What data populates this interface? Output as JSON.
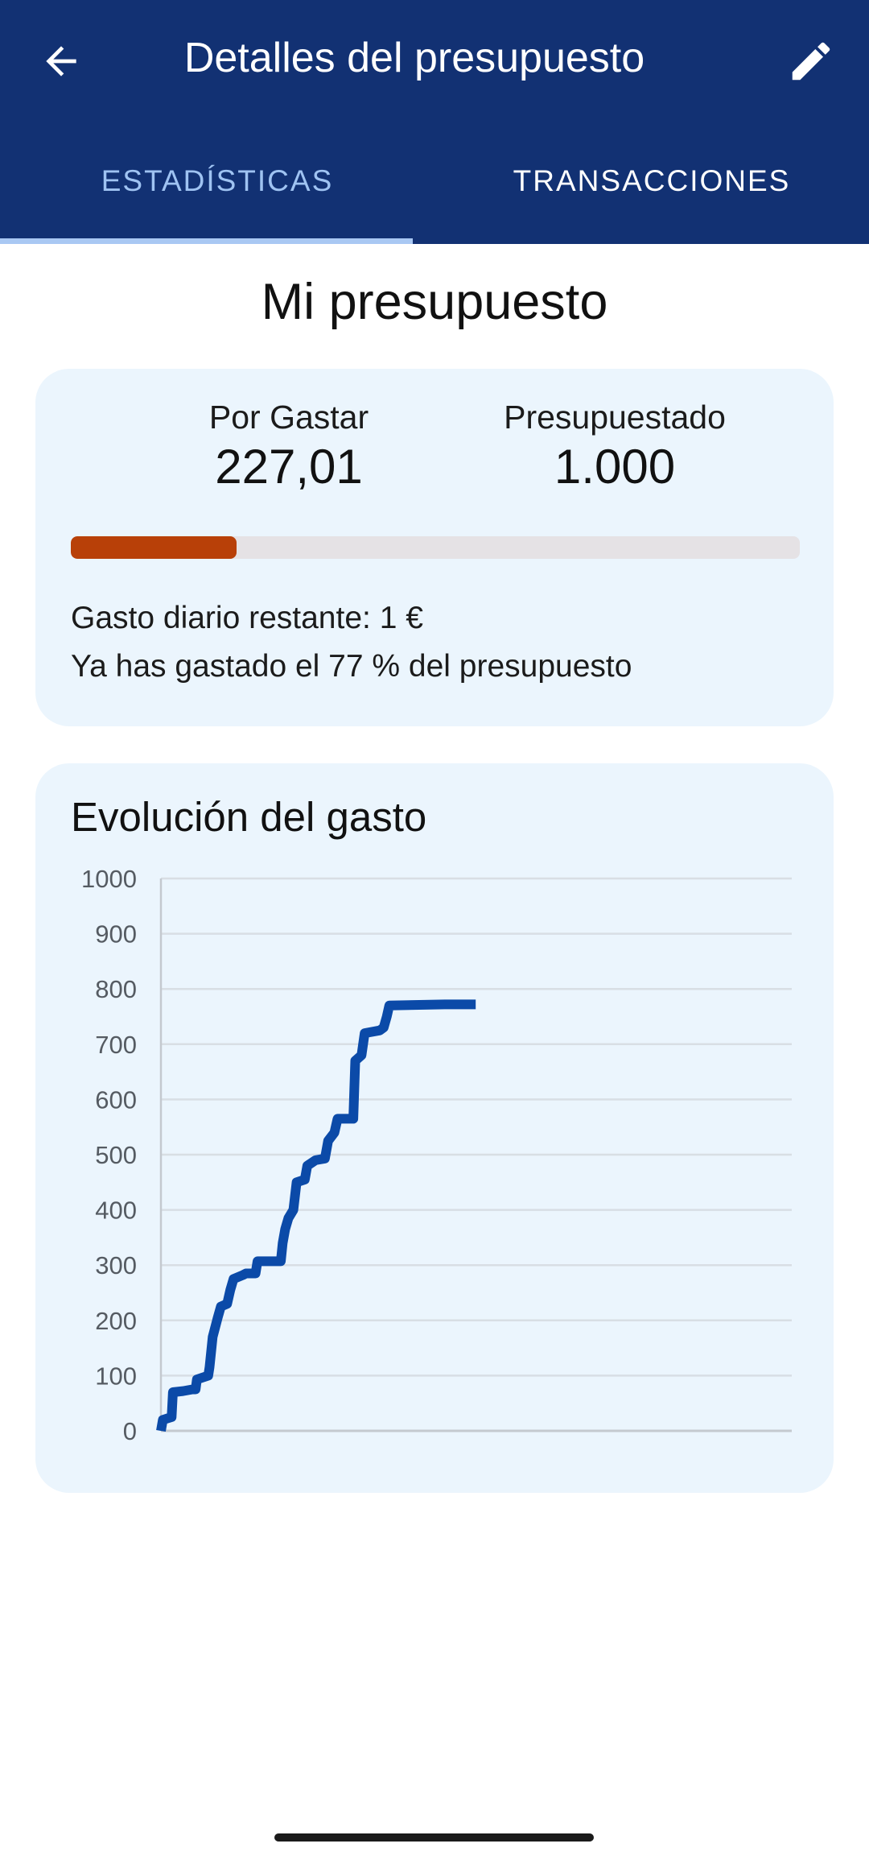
{
  "app_bar": {
    "title": "Detalles del presupuesto",
    "back_icon": "arrow-left-icon",
    "edit_icon": "pencil-icon"
  },
  "tabs": [
    {
      "label": "ESTADÍSTICAS",
      "active": true
    },
    {
      "label": "TRANSACCIONES",
      "active": false
    }
  ],
  "page_title": "Mi presupuesto",
  "summary": {
    "remaining_label": "Por Gastar",
    "remaining_value": "227,01",
    "budget_label": "Presupuestado",
    "budget_value": "1.000",
    "progress_fraction": 0.227,
    "daily_remaining": "Gasto diario restante: 1 €",
    "spent_text": "Ya has gastado el 77 % del presupuesto"
  },
  "colors": {
    "appbar": "#123173",
    "active_tab": "#9fc3f2",
    "progress_fill": "#b84008",
    "progress_track": "#e5e2e5",
    "card_bg": "#ebf5fd",
    "line": "#0b4aa8"
  },
  "chart_data": {
    "type": "line",
    "title": "Evolución del gasto",
    "xlabel": "",
    "ylabel": "",
    "ylim": [
      0,
      1000
    ],
    "yticks": [
      "0",
      "100",
      "200",
      "300",
      "400",
      "500",
      "600",
      "700",
      "800",
      "900",
      "1000"
    ],
    "grid": true,
    "legend": "none",
    "x_range": [
      0,
      100
    ],
    "series": [
      {
        "values": [
          [
            0,
            0
          ],
          [
            0.3,
            20
          ],
          [
            1.7,
            25
          ],
          [
            1.9,
            70
          ],
          [
            3.5,
            72
          ],
          [
            5,
            75
          ],
          [
            5.5,
            75
          ],
          [
            5.7,
            93
          ],
          [
            7.5,
            100
          ],
          [
            7.7,
            115
          ],
          [
            8.2,
            170
          ],
          [
            9,
            205
          ],
          [
            9.5,
            225
          ],
          [
            10.5,
            230
          ],
          [
            11,
            255
          ],
          [
            11.5,
            275
          ],
          [
            13,
            282
          ],
          [
            13.5,
            285
          ],
          [
            15,
            285
          ],
          [
            15.3,
            307
          ],
          [
            17,
            307
          ],
          [
            19,
            307
          ],
          [
            19.3,
            340
          ],
          [
            19.7,
            365
          ],
          [
            20.2,
            385
          ],
          [
            21,
            400
          ],
          [
            21.5,
            450
          ],
          [
            22.8,
            455
          ],
          [
            23.2,
            480
          ],
          [
            24.5,
            490
          ],
          [
            26,
            493
          ],
          [
            26.5,
            525
          ],
          [
            27.5,
            540
          ],
          [
            28,
            565
          ],
          [
            30.5,
            565
          ],
          [
            30.8,
            670
          ],
          [
            31.8,
            680
          ],
          [
            32.3,
            720
          ],
          [
            34.7,
            725
          ],
          [
            35.3,
            730
          ],
          [
            35.8,
            750
          ],
          [
            36.2,
            770
          ],
          [
            45,
            772
          ],
          [
            49.9,
            772
          ]
        ]
      }
    ]
  }
}
